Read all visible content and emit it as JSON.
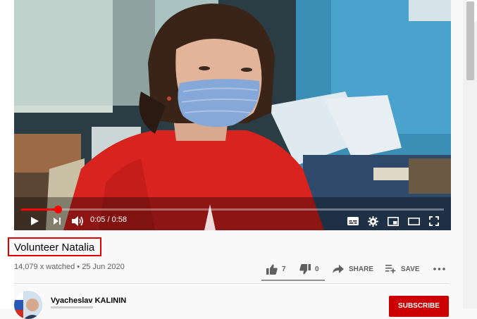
{
  "player": {
    "time_current": "0:05",
    "time_total": "0:58",
    "time_display": "0:05 / 0:58",
    "progress_fraction": 0.086
  },
  "video": {
    "title": "Volunteer Natalia",
    "views_date": "14,079 x watched • 25 Jun 2020"
  },
  "actions": {
    "like_count": "7",
    "dislike_count": "0",
    "share_label": "SHARE",
    "save_label": "SAVE"
  },
  "channel": {
    "name": "Vyacheslav KALININ",
    "subscribe_label": "SUBSCRIBE"
  },
  "colors": {
    "accent_red": "#ff0000",
    "subscribe_red": "#cc0000",
    "highlight_box": "#e00000"
  },
  "icons": [
    "play-icon",
    "next-icon",
    "volume-icon",
    "subtitles-icon",
    "settings-icon",
    "miniplayer-icon",
    "theater-icon",
    "fullscreen-icon",
    "like-icon",
    "dislike-icon",
    "share-icon",
    "save-playlist-icon",
    "more-icon"
  ]
}
